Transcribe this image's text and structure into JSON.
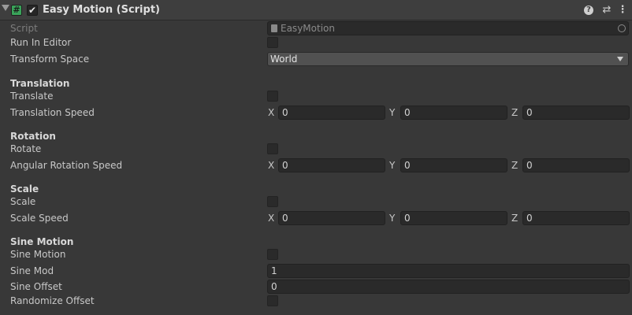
{
  "header": {
    "title": "Easy Motion (Script)",
    "script_icon_glyph": "#",
    "enabled_glyph": "✔",
    "help_glyph": "?",
    "settings_glyph": "⇄",
    "menu_glyph": "⋮"
  },
  "fields": {
    "script": {
      "label": "Script",
      "value": "EasyMotion"
    },
    "run_in_editor": {
      "label": "Run In Editor",
      "checked": false
    },
    "transform_space": {
      "label": "Transform Space",
      "value": "World"
    }
  },
  "sections": {
    "translation": {
      "title": "Translation",
      "toggle_label": "Translate",
      "speed_label": "Translation Speed",
      "x": "0",
      "y": "0",
      "z": "0"
    },
    "rotation": {
      "title": "Rotation",
      "toggle_label": "Rotate",
      "speed_label": "Angular Rotation Speed",
      "x": "0",
      "y": "0",
      "z": "0"
    },
    "scale": {
      "title": "Scale",
      "toggle_label": "Scale",
      "speed_label": "Scale Speed",
      "x": "0",
      "y": "0",
      "z": "0"
    },
    "sine": {
      "title": "Sine Motion",
      "toggle_label": "Sine Motion",
      "mod_label": "Sine Mod",
      "mod_value": "1",
      "offset_label": "Sine Offset",
      "offset_value": "0",
      "randomize_label": "Randomize Offset"
    }
  },
  "axes": {
    "x": "X",
    "y": "Y",
    "z": "Z"
  },
  "colors": {
    "background": "#383838",
    "header": "#3e3e3e",
    "field": "#2a2a2a",
    "script_icon": "#3aa35a"
  }
}
